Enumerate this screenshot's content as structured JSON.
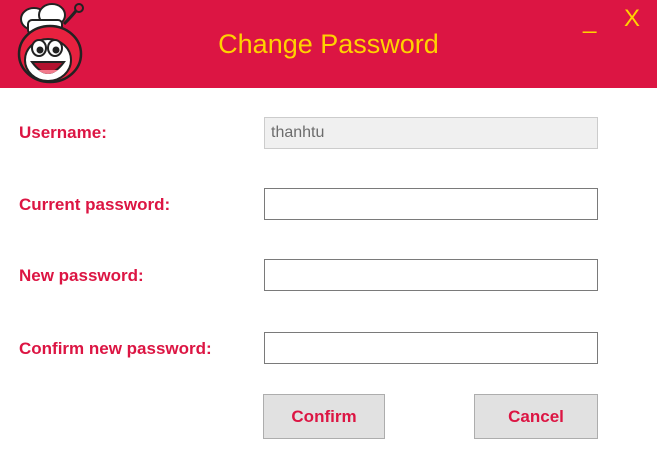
{
  "window": {
    "title": "Change Password",
    "minimize_label": "_",
    "close_label": "X",
    "logo_icon": "jollibee-mascot-icon",
    "accent_color": "#dc1543",
    "title_color": "#ffd200"
  },
  "form": {
    "username": {
      "label": "Username:",
      "value": "thanhtu"
    },
    "current_password": {
      "label": "Current password:",
      "value": ""
    },
    "new_password": {
      "label": "New password:",
      "value": ""
    },
    "confirm_password": {
      "label": "Confirm new password:",
      "value": ""
    }
  },
  "actions": {
    "confirm_label": "Confirm",
    "cancel_label": "Cancel"
  }
}
